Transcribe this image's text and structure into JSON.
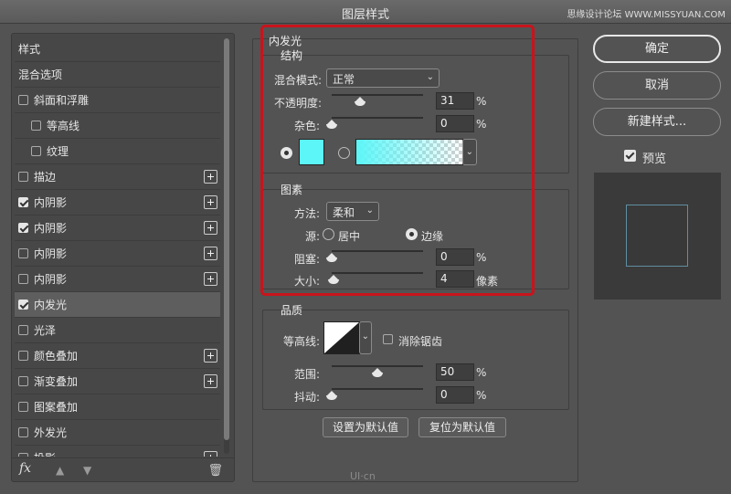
{
  "window": {
    "title": "图层样式",
    "watermark": "思缘设计论坛 WWW.MISSYUAN.COM"
  },
  "sidebar": {
    "items": [
      {
        "label": "样式",
        "checkbox": false,
        "plus": false,
        "indent": false
      },
      {
        "label": "混合选项",
        "checkbox": false,
        "plus": false,
        "indent": false
      },
      {
        "label": "斜面和浮雕",
        "checkbox": true,
        "checked": false,
        "plus": false,
        "indent": false
      },
      {
        "label": "等高线",
        "checkbox": true,
        "checked": false,
        "plus": false,
        "indent": true
      },
      {
        "label": "纹理",
        "checkbox": true,
        "checked": false,
        "plus": false,
        "indent": true
      },
      {
        "label": "描边",
        "checkbox": true,
        "checked": false,
        "plus": true,
        "indent": false
      },
      {
        "label": "内阴影",
        "checkbox": true,
        "checked": true,
        "plus": true,
        "indent": false
      },
      {
        "label": "内阴影",
        "checkbox": true,
        "checked": true,
        "plus": true,
        "indent": false
      },
      {
        "label": "内阴影",
        "checkbox": true,
        "checked": false,
        "plus": true,
        "indent": false
      },
      {
        "label": "内阴影",
        "checkbox": true,
        "checked": false,
        "plus": true,
        "indent": false
      },
      {
        "label": "内发光",
        "checkbox": true,
        "checked": true,
        "plus": false,
        "indent": false,
        "selected": true
      },
      {
        "label": "光泽",
        "checkbox": true,
        "checked": false,
        "plus": false,
        "indent": false
      },
      {
        "label": "颜色叠加",
        "checkbox": true,
        "checked": false,
        "plus": true,
        "indent": false
      },
      {
        "label": "渐变叠加",
        "checkbox": true,
        "checked": false,
        "plus": true,
        "indent": false
      },
      {
        "label": "图案叠加",
        "checkbox": true,
        "checked": false,
        "plus": false,
        "indent": false
      },
      {
        "label": "外发光",
        "checkbox": true,
        "checked": false,
        "plus": false,
        "indent": false
      },
      {
        "label": "投影",
        "checkbox": true,
        "checked": false,
        "plus": true,
        "indent": false
      }
    ],
    "footer": {
      "fx": "fx",
      "up_icon": "arrow-up-icon",
      "down_icon": "arrow-down-icon",
      "trash_icon": "trash-icon"
    }
  },
  "inner_glow": {
    "title": "内发光",
    "structure": {
      "title": "结构",
      "blend_label": "混合模式:",
      "blend_value": "正常",
      "opacity_label": "不透明度:",
      "opacity_value": "31",
      "opacity_unit": "%",
      "opacity": 0.31,
      "noise_label": "杂色:",
      "noise_value": "0",
      "noise_unit": "%",
      "noise": 0,
      "solid_color": "#5cf6f8",
      "gradient_from": "#5cf6f8"
    },
    "elements": {
      "title": "图素",
      "method_label": "方法:",
      "method_value": "柔和",
      "source_label": "源:",
      "source_center": "居中",
      "source_edge": "边缘",
      "source_selected": "edge",
      "choke_label": "阻塞:",
      "choke_value": "0",
      "choke_unit": "%",
      "choke": 0,
      "size_label": "大小:",
      "size_value": "4",
      "size_unit": "像素",
      "size": 0.016
    },
    "quality": {
      "title": "品质",
      "contour_label": "等高线:",
      "antialias_label": "消除锯齿",
      "antialias": false,
      "range_label": "范围:",
      "range_value": "50",
      "range_unit": "%",
      "range": 0.5,
      "jitter_label": "抖动:",
      "jitter_value": "0",
      "jitter_unit": "%",
      "jitter": 0
    },
    "make_default": "设置为默认值",
    "reset_default": "复位为默认值"
  },
  "actions": {
    "ok": "确定",
    "cancel": "取消",
    "new_style": "新建样式...",
    "preview_label": "预览",
    "preview_checked": true
  },
  "logo": "UI·cn"
}
